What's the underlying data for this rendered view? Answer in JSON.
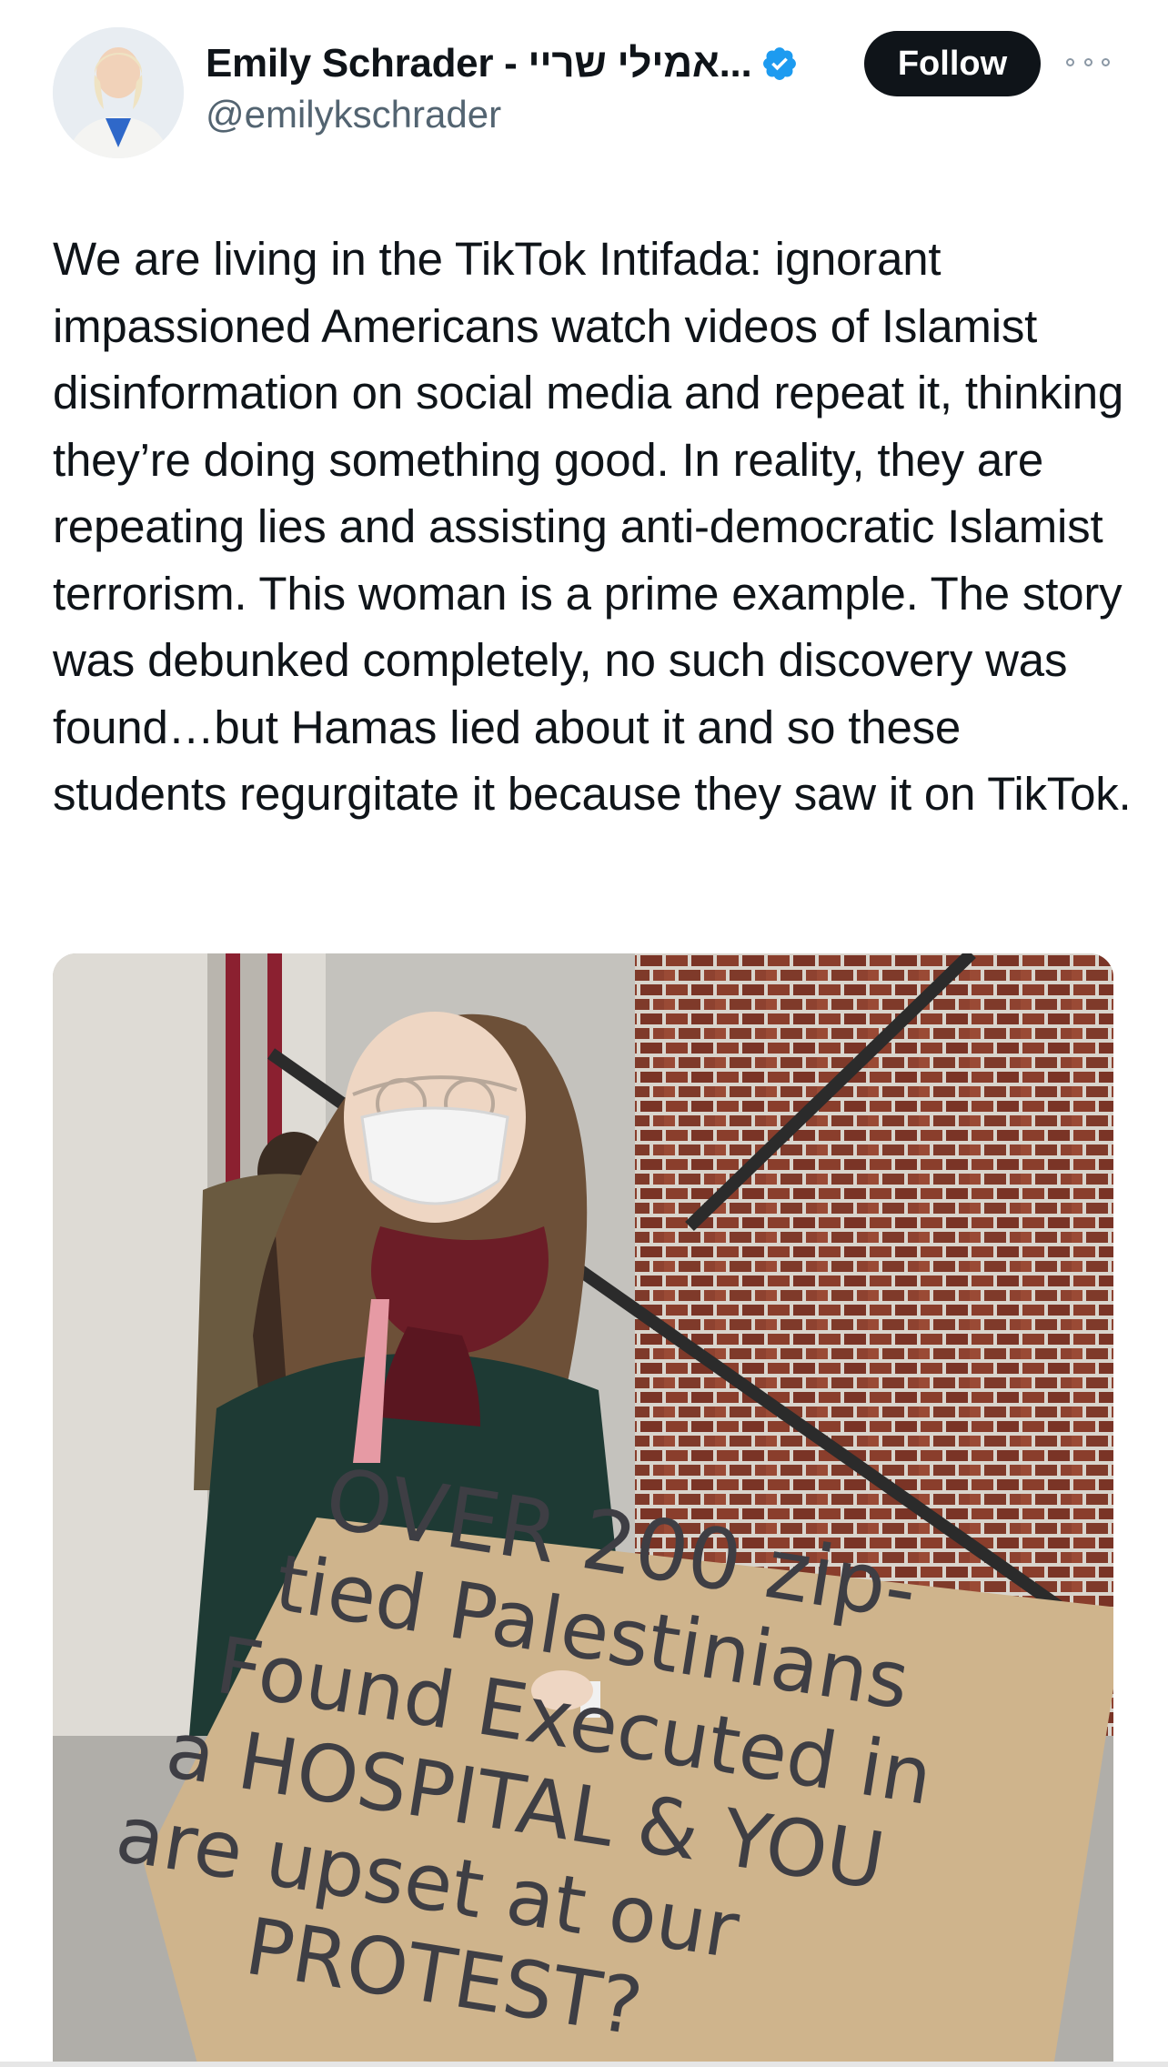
{
  "author": {
    "display_name": "Emily Schrader - אמילי שריי...",
    "handle": "@emilykschrader",
    "verified": true,
    "verified_color": "#1d9bf0"
  },
  "actions": {
    "follow_label": "Follow",
    "more_icon": "more-horizontal-icon"
  },
  "tweet": {
    "text": "We are living in the TikTok Intifada: ignorant impassioned Americans watch videos of Islamist disinformation on social media and repeat it, thinking they’re doing something good. In reality, they are repeating lies and assisting anti-democratic Islamist terrorism. This woman is a prime example. The story was debunked completely, no such discovery was found…but Hamas lied about it and so these students regurgitate it because they saw it on TikTok."
  },
  "media": {
    "sign_lines": [
      "OVER 200 zip-",
      "tied Palestinians",
      "Found Executed in",
      "a HOSPITAL & YOU",
      "are upset at our",
      "PROTEST?"
    ]
  },
  "colors": {
    "text_primary": "#0f1419",
    "text_secondary": "#536471",
    "follow_bg": "#0f1419",
    "follow_text": "#ffffff"
  }
}
